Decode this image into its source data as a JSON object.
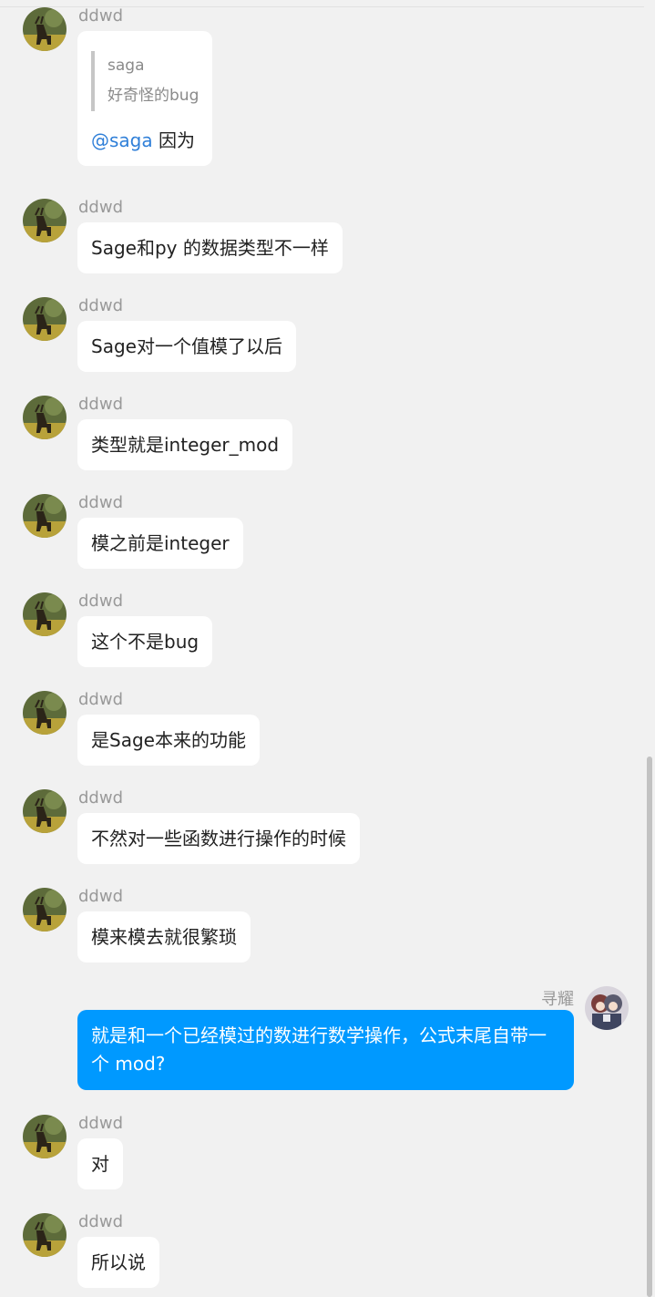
{
  "messages": [
    {
      "sender": "ddwd",
      "quote_name": "saga",
      "quote_text": "好奇怪的bug",
      "mention": "@saga",
      "text": " 因为"
    },
    {
      "sender": "ddwd",
      "text": "Sage和py 的数据类型不一样"
    },
    {
      "sender": "ddwd",
      "text": "Sage对一个值模了以后"
    },
    {
      "sender": "ddwd",
      "text": "类型就是integer_mod"
    },
    {
      "sender": "ddwd",
      "text": "模之前是integer"
    },
    {
      "sender": "ddwd",
      "text": "这个不是bug"
    },
    {
      "sender": "ddwd",
      "text": "是Sage本来的功能"
    },
    {
      "sender": "ddwd",
      "text": "不然对一些函数进行操作的时候"
    },
    {
      "sender": "ddwd",
      "text": "模来模去就很繁琐"
    },
    {
      "sender": "寻耀",
      "self": true,
      "text": "就是和一个已经模过的数进行数学操作，公式末尾自带一个 mod?"
    },
    {
      "sender": "ddwd",
      "text": "对"
    },
    {
      "sender": "ddwd",
      "text": "所以说"
    }
  ],
  "colors": {
    "background": "#f1f1f1",
    "bubble_other": "#ffffff",
    "bubble_self": "#0099ff",
    "mention": "#2f7fd8",
    "sender_name": "#999999"
  },
  "icons": {
    "other_avatar": "deer-avatar-icon",
    "self_avatar": "anime-avatar-icon"
  }
}
